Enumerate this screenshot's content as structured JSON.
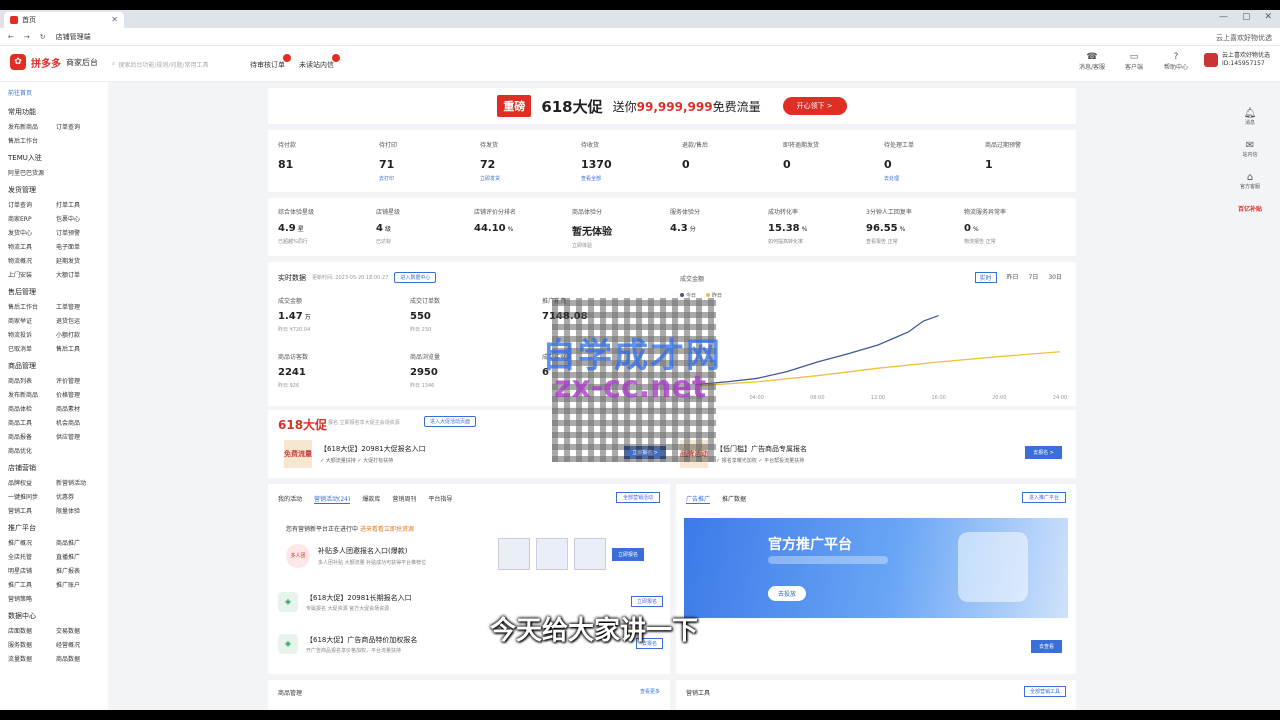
{
  "browser": {
    "tab_title": "首页",
    "url": "店铺管理端",
    "right_text": "云上喜欢好物优选"
  },
  "header": {
    "brand": "拼多多",
    "brand_sub": "商家后台",
    "search_placeholder": "搜索后台功能/规则/问题/常用工具",
    "nav": [
      "待审核订单",
      "未读站内信"
    ],
    "right_items": [
      "消息/客服",
      "客户端",
      "帮助中心"
    ],
    "shop_name": "云上喜欢好物优选",
    "shop_id": "ID:145957157"
  },
  "sidebar": {
    "home": "前往首页",
    "sections": [
      {
        "title": "常用功能",
        "items": [
          "发布新商品",
          "订单查询",
          "售后工作台"
        ]
      },
      {
        "title": "TEMU入驻",
        "items": [
          "阿里巴巴货源"
        ]
      },
      {
        "title": "发货管理",
        "items": [
          "订单查询",
          "打单工具",
          "商家ERP",
          "包裹中心",
          "发货中心",
          "订单预警",
          "物流工具",
          "电子面单",
          "物流概况",
          "延期发货",
          "上门安装",
          "大额订单"
        ]
      },
      {
        "title": "售后管理",
        "items": [
          "售后工作台",
          "工单管理",
          "商家举证",
          "退货包运",
          "物流投诉",
          "小额打款",
          "已取消单",
          "售后工具"
        ]
      },
      {
        "title": "商品管理",
        "items": [
          "商品列表",
          "评价管理",
          "发布新商品",
          "价格管理",
          "商品体检",
          "商品素材",
          "商品工具",
          "机会商品",
          "商品报备",
          "供应管理",
          "商品优化"
        ]
      },
      {
        "title": "店铺营销",
        "items": [
          "品牌权益",
          "新营销活动",
          "一键推同步",
          "优惠券",
          "营销工具",
          "限量体验"
        ]
      },
      {
        "title": "推广平台",
        "items": [
          "推广概况",
          "商品推广",
          "全店托管",
          "直播推广",
          "明星店铺",
          "推广报表",
          "推广工具",
          "推广账户",
          "营销策略"
        ]
      },
      {
        "title": "数据中心",
        "items": [
          "店面数据",
          "交易数据",
          "服务数据",
          "经营概况",
          "流量数据",
          "商品数据"
        ]
      }
    ]
  },
  "banner": {
    "chip": "重磅",
    "title": "618大促",
    "prefix": "送你",
    "amount": "99,999,999",
    "suffix": "免费流量",
    "button": "开心领下 >"
  },
  "stats": [
    {
      "label": "待付款",
      "value": "81",
      "sub": ""
    },
    {
      "label": "待打印",
      "value": "71",
      "sub": "去打印"
    },
    {
      "label": "待发货",
      "value": "72",
      "sub": "立即发货"
    },
    {
      "label": "待收货",
      "value": "1370",
      "sub": "查看全部"
    },
    {
      "label": "退款/售后",
      "value": "0",
      "sub": ""
    },
    {
      "label": "即将逾期发货",
      "value": "0",
      "sub": ""
    },
    {
      "label": "待处理工单",
      "value": "0",
      "sub": "去处理"
    },
    {
      "label": "商品过期预警",
      "value": "1",
      "sub": ""
    }
  ],
  "metrics": [
    {
      "label": "综合体验星级",
      "value": "4.9",
      "unit": "星",
      "sub": "已超越%同行"
    },
    {
      "label": "店铺星级",
      "value": "4",
      "unit": "级",
      "sub": "已达标"
    },
    {
      "label": "店铺评价分排名",
      "value": "44.10",
      "unit": "%",
      "sub": ""
    },
    {
      "label": "商品体验分",
      "value": "暂无体验",
      "unit": "",
      "sub": "立即体验"
    },
    {
      "label": "服务体验分",
      "value": "4.3",
      "unit": "分",
      "sub": ""
    },
    {
      "label": "成功转化率",
      "value": "15.38",
      "unit": "%",
      "sub": "如何提高转化率"
    },
    {
      "label": "3分钟人工回复率",
      "value": "96.55",
      "unit": "%",
      "sub": "查看报告  正常"
    },
    {
      "label": "物流服务异常率",
      "value": "0",
      "unit": "%",
      "sub": "物流报告  正常"
    }
  ],
  "realtime": {
    "title": "实时数据",
    "updated": "更新时间: 2023-05-20 18:00:27",
    "button": "进入数据中心",
    "items": [
      {
        "label": "成交金额",
        "value": "1.47",
        "unit": "万",
        "sub": "昨日 ¥720.04"
      },
      {
        "label": "成交订单数",
        "value": "550",
        "unit": "",
        "sub": "昨日 230"
      },
      {
        "label": "推广花费",
        "value": "7148.08",
        "unit": "",
        "sub": ""
      },
      {
        "label": "商品访客数",
        "value": "2241",
        "unit": "",
        "sub": "昨日 926"
      },
      {
        "label": "商品浏览量",
        "value": "2950",
        "unit": "",
        "sub": "昨日 1346"
      },
      {
        "label": "成交买家数",
        "value": "6",
        "unit": "",
        "sub": ""
      }
    ],
    "periods": [
      "实时",
      "昨日",
      "7日",
      "30日"
    ]
  },
  "chart_data": {
    "type": "line",
    "title": "成交金额",
    "xlabel": "",
    "ylabel": "",
    "x": [
      "00:00",
      "04:00",
      "08:00",
      "12:00",
      "16:00",
      "20:00",
      "24:00"
    ],
    "series": [
      {
        "name": "今日",
        "color": "#3d5a99",
        "points": [
          [
            0,
            0.5
          ],
          [
            2,
            0.9
          ],
          [
            4,
            1.4
          ],
          [
            6,
            2.4
          ],
          [
            8,
            3.8
          ],
          [
            10,
            5.0
          ],
          [
            12,
            6.3
          ],
          [
            14,
            8.2
          ],
          [
            15,
            9.8
          ],
          [
            16,
            10.6
          ]
        ]
      },
      {
        "name": "昨日",
        "color": "#f0c040",
        "points": [
          [
            0,
            0.3
          ],
          [
            4,
            0.9
          ],
          [
            8,
            1.8
          ],
          [
            12,
            2.9
          ],
          [
            16,
            3.8
          ],
          [
            20,
            4.6
          ],
          [
            24,
            5.3
          ]
        ]
      }
    ],
    "ylim": [
      0,
      12
    ],
    "xlim": [
      0,
      24
    ],
    "grid": false,
    "legend": "top-left"
  },
  "promo": {
    "title": "618大促",
    "desc": "报名  立即报名享大促主会场资源",
    "button": "进入大促活动页面",
    "items": [
      {
        "icon": "免费流量",
        "title": "【618大促】20981大促报名入口",
        "sub": "✓ 大额流量扶持    ✓ 大促打标扶持",
        "button": "立即报名 >"
      },
      {
        "icon": "品牌活动",
        "title": "【低门槛】广告商品专属报名",
        "sub": "✓ 报名享曝光加权    ✓ 平台帮投流量扶持",
        "button": "去报名 >"
      }
    ]
  },
  "activity": {
    "tabs": [
      "我的活动",
      "营销活动(24)",
      "爆款库",
      "营销周刊",
      "平台指导"
    ],
    "link": "全部营销活动",
    "headline": "您有营销新平台正在进行中",
    "headline_tag": "进来看看立即抢资源",
    "main_title": "补贴多人团邀报名入口(爆款)",
    "main_sub": "多人团补贴  大额流量  补贴成功可获得平台推荐位",
    "main_badge": "多人团",
    "main_button": "立即报名",
    "rows": [
      {
        "title": "【618大促】20981长期报名入口",
        "sub": "专属报名  大促资源  官方大促会场资源",
        "button": "立即报名"
      },
      {
        "title": "【618大促】广告商品特价加权报名",
        "sub": "开广告商品报名享价格加权，平台流量扶持",
        "button": "去报名"
      }
    ]
  },
  "ads": {
    "tabs": [
      "广告推广",
      "推广数据"
    ],
    "link": "进入推广平台",
    "banner_title": "官方推广平台",
    "banner_button": "去投放",
    "button": "去查看"
  },
  "bottom": {
    "left_title": "商品管理",
    "left_link": "查看更多",
    "right_title": "营销工具",
    "right_link": "全部营销工具"
  },
  "rail": [
    "消息",
    "站内信",
    "官方客服"
  ],
  "rail_promo": "百亿补贴",
  "watermark": {
    "line1": "自学成才网",
    "line2": "zx-cc.net"
  },
  "subtitle": "今天给大家讲一下"
}
